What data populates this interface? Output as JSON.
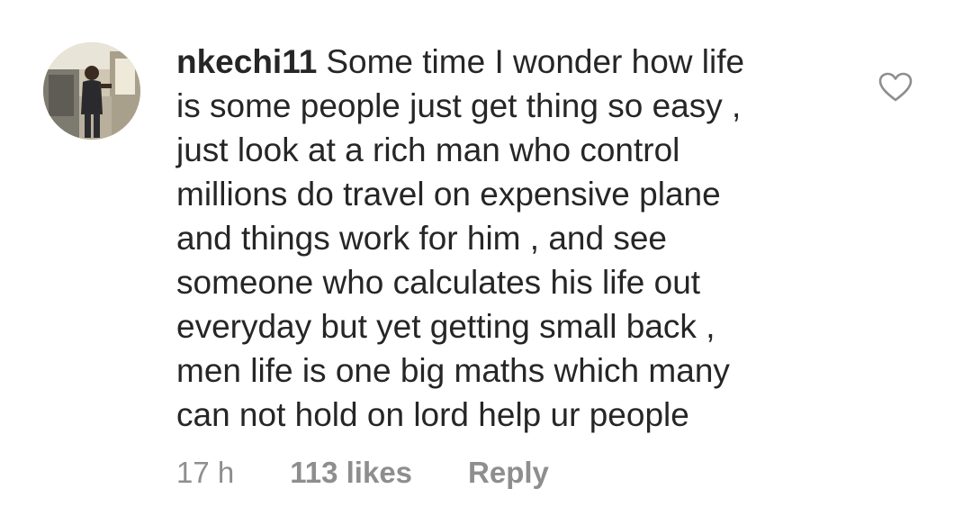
{
  "comment": {
    "username": "nkechi11",
    "text_lines": [
      "Some time I wonder how life",
      "is some people just get thing so easy ,",
      "just look at a rich man who control",
      "millions do travel on expensive plane",
      "and things work for him , and see",
      "someone who calculates his life out",
      "everyday but yet getting small back ,",
      "men life is one big maths which many",
      "can not hold on lord help ur people"
    ],
    "time": "17 h",
    "likes": "113 likes",
    "reply": "Reply"
  },
  "icons": {
    "like": "heart-outline-icon",
    "avatar": "user-avatar-photo"
  },
  "colors": {
    "text": "#262626",
    "secondary": "#8e8e8e",
    "icon": "#8e8e8e"
  }
}
